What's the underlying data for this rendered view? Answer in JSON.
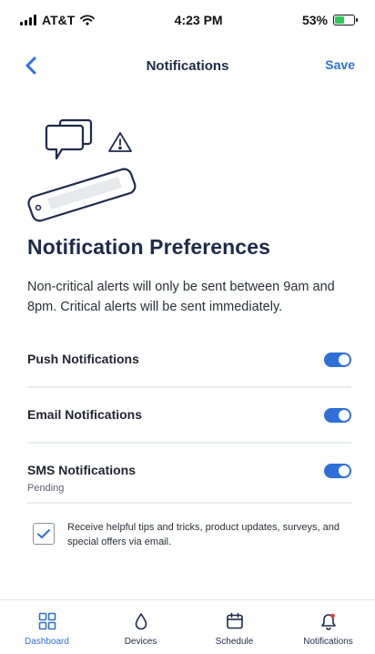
{
  "status_bar": {
    "carrier": "AT&T",
    "time": "4:23 PM",
    "battery_percent": "53%",
    "battery_level": 0.53,
    "icons": [
      "signal-icon",
      "wifi-icon",
      "battery-icon"
    ]
  },
  "nav": {
    "title": "Notifications",
    "save_label": "Save",
    "back_icon": "chevron-left-icon"
  },
  "colors": {
    "accent": "#2f6fd6",
    "title": "#1e2a4a",
    "text": "#1f2430",
    "divider": "#e8eaee",
    "battery": "#33c659"
  },
  "illustration": {
    "icons": [
      "chat-bubbles-icon",
      "warning-icon",
      "phone-icon"
    ]
  },
  "preferences": {
    "title": "Notification Preferences",
    "description": "Non-critical alerts will only be sent between 9am and 8pm. Critical alerts will be sent immediately.",
    "settings": [
      {
        "label": "Push Notifications",
        "enabled": true
      },
      {
        "label": "Email Notifications",
        "enabled": true
      },
      {
        "label": "SMS Notifications",
        "enabled": true,
        "status": "Pending"
      }
    ],
    "marketing_opt_in": {
      "checked": true,
      "label": "Receive helpful tips and tricks, product updates, surveys, and special offers via email."
    }
  },
  "tabs": [
    {
      "label": "Dashboard",
      "icon": "grid-icon"
    },
    {
      "label": "Devices",
      "icon": "water-drop-icon"
    },
    {
      "label": "Schedule",
      "icon": "calendar-icon"
    },
    {
      "label": "Notifications",
      "icon": "bell-icon",
      "active": true
    }
  ]
}
